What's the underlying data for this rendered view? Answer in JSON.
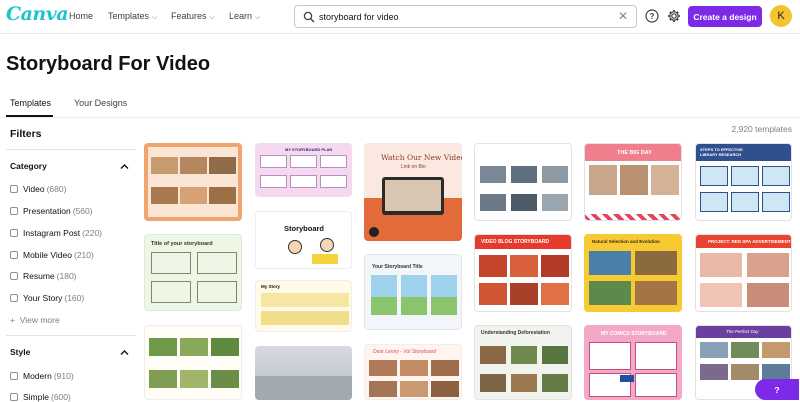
{
  "nav": {
    "logo": "Canva",
    "items": [
      {
        "label": "Home"
      },
      {
        "label": "Templates"
      },
      {
        "label": "Features"
      },
      {
        "label": "Learn"
      }
    ],
    "search_value": "storyboard for video",
    "search_placeholder": "Search",
    "create_label": "Create a design",
    "avatar_letter": "K",
    "help_symbol": "?"
  },
  "page": {
    "title": "Storyboard For Video",
    "tabs": [
      {
        "label": "Templates"
      },
      {
        "label": "Your Designs"
      }
    ],
    "template_count": "2,920 templates"
  },
  "filters": {
    "title": "Filters",
    "category": {
      "label": "Category",
      "items": [
        {
          "label": "Video",
          "count": "(680)"
        },
        {
          "label": "Presentation",
          "count": "(560)"
        },
        {
          "label": "Instagram Post",
          "count": "(220)"
        },
        {
          "label": "Mobile Video",
          "count": "(210)"
        },
        {
          "label": "Resume",
          "count": "(180)"
        },
        {
          "label": "Your Story",
          "count": "(160)"
        }
      ],
      "view_more": "View more"
    },
    "style": {
      "label": "Style",
      "items": [
        {
          "label": "Modern",
          "count": "(910)"
        },
        {
          "label": "Simple",
          "count": "(600)"
        }
      ]
    }
  },
  "templates": {
    "t2_title": "MY STORYBOARD PLAN",
    "t3_title": "Watch Our New Video",
    "t3_sub": "Link on Bio",
    "t5_title": "THE BIG DAY",
    "t6_title": "STEPS TO EFFECTIVE LIBRARY RESEARCH",
    "t8_title": "Title of your storyboard",
    "t9_title": "Storyboard",
    "t11_title": "Your Storyboard Title",
    "t12_title": "VIDEO BLOG STORYBOARD",
    "t13_title": "Natural Selection and Evolution",
    "t14_title": "PROJECT: RED SPA ADVERTISEMENT",
    "t15_title": "My Story",
    "t18_title": "Dear Lenny - Vol Storyboard",
    "t19_title": "Understanding Deforestation",
    "t20_title": "MY COMICS STORYBOARD",
    "t21_title": "The Perfect Day"
  },
  "colors": {
    "accent": "#7d2ae8",
    "logo": "#20c4cb",
    "avatar": "#f4c430"
  }
}
